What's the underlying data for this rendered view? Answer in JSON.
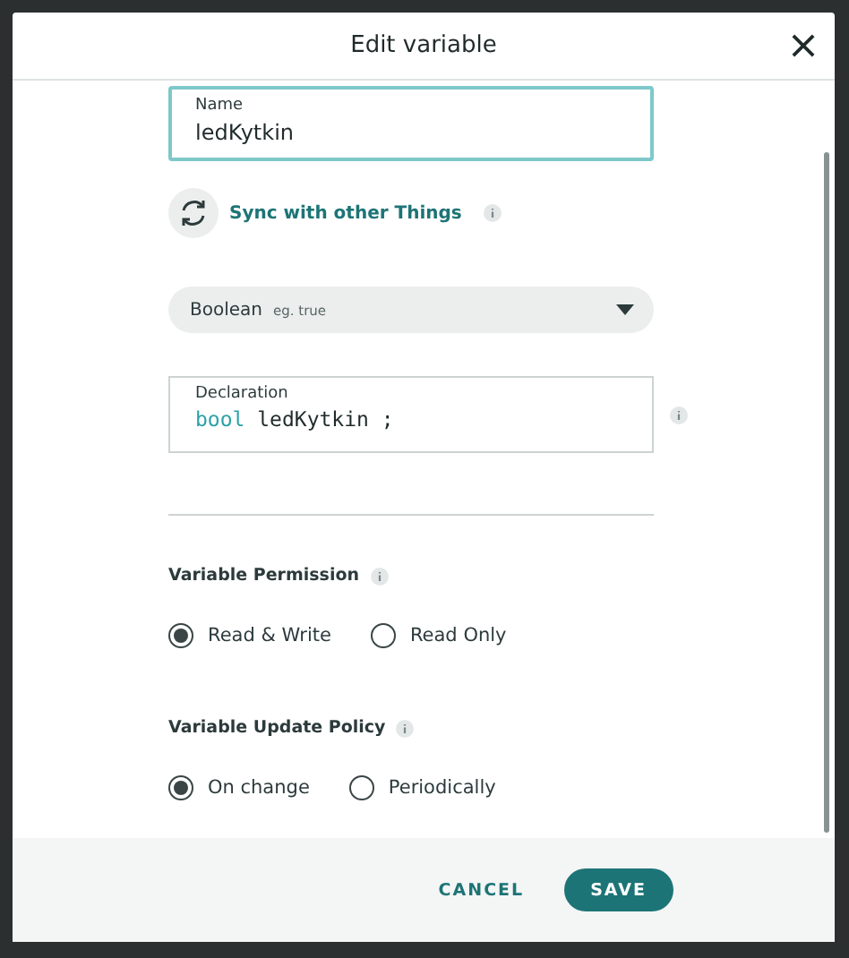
{
  "dialog": {
    "title": "Edit variable"
  },
  "name_field": {
    "label": "Name",
    "value": "ledKytkin"
  },
  "sync": {
    "label": "Sync with other Things"
  },
  "type_select": {
    "value": "Boolean",
    "hint": "eg. true"
  },
  "declaration": {
    "label": "Declaration",
    "keyword": "bool",
    "name": "ledKytkin",
    "terminator": ";"
  },
  "groups": [
    {
      "title": "Variable Permission",
      "options": [
        {
          "label": "Read & Write",
          "selected": true
        },
        {
          "label": "Read Only",
          "selected": false
        }
      ]
    },
    {
      "title": "Variable Update Policy",
      "options": [
        {
          "label": "On change",
          "selected": true
        },
        {
          "label": "Periodically",
          "selected": false
        }
      ]
    }
  ],
  "buttons": {
    "cancel": "CANCEL",
    "save": "SAVE"
  }
}
